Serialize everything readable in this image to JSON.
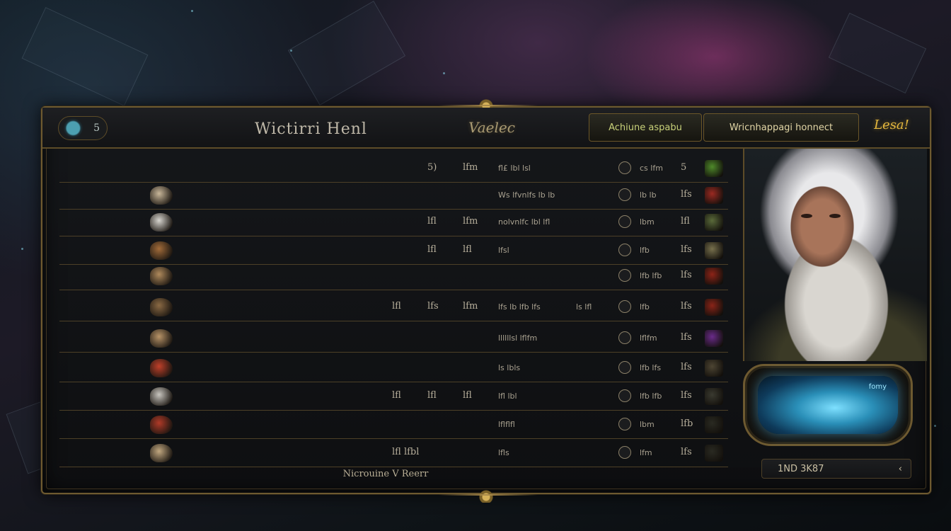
{
  "header": {
    "emblem_text": "5",
    "title": "Wictirri Henl",
    "logo_text": "Vaelec",
    "btn_a_label": "Achiune aspabu",
    "btn_b_label": "Wricnhappagi honnect",
    "gold_counter": "Lesa!"
  },
  "rows": [
    {
      "icon_color": "none",
      "c1": "",
      "c2": "5)",
      "c3": "lfm",
      "c4": "fl£ lbl  lsl",
      "c5": "",
      "c6": "cs lfm",
      "c7": "5",
      "rarity_color": "#4f8a2a"
    },
    {
      "icon_color": "#c9b79a",
      "c1": "",
      "c2": "",
      "c3": "",
      "c4": "Ws lfvnlfs lb lb",
      "c5": "",
      "c6": "lb  lb",
      "c7": "lfs",
      "rarity_color": "#9b2a22"
    },
    {
      "icon_color": "#d8d6d0",
      "c1": "",
      "c2": "lfl",
      "c3": "lfm",
      "c4": "nolvnlfc lbl lfl",
      "c5": "",
      "c6": "lbm",
      "c7": "lfl",
      "rarity_color": "#5a6a3a"
    },
    {
      "icon_color": "#a26c3a",
      "c1": "",
      "c2": "lfl",
      "c3": "lfl",
      "c4": "lfsl",
      "c5": "",
      "c6": "lfb",
      "c7": "lfs",
      "rarity_color": "#77704d"
    },
    {
      "icon_color": "#b08a5c",
      "c1": "",
      "c2": "",
      "c3": "",
      "c4": "",
      "c5": "",
      "c6": "lfb lfb",
      "c7": "lfs",
      "rarity_color": "#8d2418"
    },
    {
      "icon_color": "#8b6a44",
      "c1": "lfl",
      "c2": "lfs",
      "c3": "lfm",
      "c4": "lfs lb lfb lfs",
      "c5": "ls lfl",
      "c6": "lfb",
      "c7": "lfs",
      "rarity_color": "#8a2418"
    },
    {
      "icon_color": "#b99468",
      "c1": "",
      "c2": "",
      "c3": "",
      "c4": "llllllsl lflfm",
      "c5": "",
      "c6": "lflfm",
      "c7": "lfs",
      "rarity_color": "#6a2b8a"
    },
    {
      "icon_color": "#c0402a",
      "c1": "",
      "c2": "",
      "c3": "",
      "c4": "ls lbls",
      "c5": "",
      "c6": "lfb lfs",
      "c7": "lfs",
      "rarity_color": "#4d4533"
    },
    {
      "icon_color": "#c9c6c0",
      "c1": "lfl",
      "c2": "lfl",
      "c3": "lfl",
      "c4": "lfl lbl",
      "c5": "",
      "c6": "lfb lfb",
      "c7": "lfs",
      "rarity_color": "#3a3a30"
    },
    {
      "icon_color": "#b03a28",
      "c1": "",
      "c2": "",
      "c3": "",
      "c4": "lflflfl",
      "c5": "",
      "c6": "lbm",
      "c7": "lfb",
      "rarity_color": "#2a2a22"
    },
    {
      "icon_color": "#c2a880",
      "c1": "lfl lfbl",
      "c2": "",
      "c3": "",
      "c4": "lfls",
      "c5": "",
      "c6": "lfm",
      "c7": "lfs",
      "rarity_color": "#2a2a22"
    }
  ],
  "portrait": {
    "crystal_label": "fomy"
  },
  "code_bar": {
    "value": "1ND 3K87",
    "arrow": "‹"
  },
  "footer": {
    "label": "Nicrouine V Reerr"
  },
  "colors": {
    "gold_border": "#6e5a30",
    "gold_text": "#e5b83e",
    "crystal_blue": "#2a8fb8"
  }
}
